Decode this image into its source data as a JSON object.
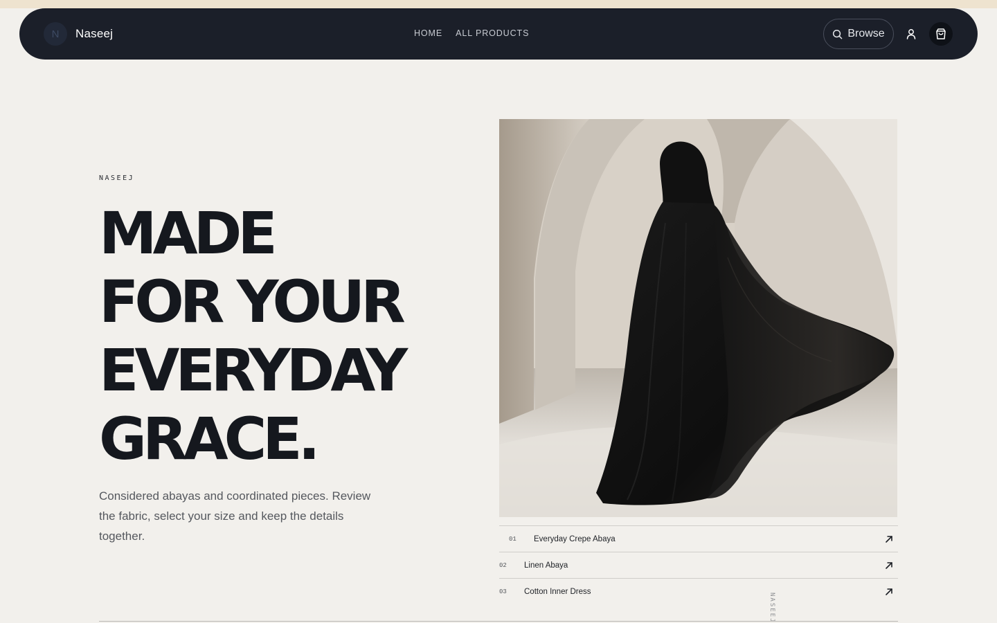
{
  "brand": {
    "mark": "N",
    "name": "Naseej"
  },
  "nav": {
    "links": [
      {
        "label": "HOME"
      },
      {
        "label": "ALL PRODUCTS"
      }
    ],
    "browse_label": "Browse",
    "icons": {
      "search": "search-icon",
      "user": "user-icon",
      "cart": "shopping-bag-icon"
    }
  },
  "hero": {
    "eyebrow": "NASEEJ",
    "title_lines": [
      "MADE",
      "FOR YOUR",
      "EVERYDAY",
      "GRACE."
    ],
    "description": "Considered abayas and coordinated pieces. Review the fabric, select your size and keep the details together."
  },
  "products": [
    {
      "num": "01",
      "name": "Everyday Crepe Abaya"
    },
    {
      "num": "02",
      "name": "Linen Abaya"
    },
    {
      "num": "03",
      "name": "Cotton Inner Dress"
    }
  ],
  "vertical_label": "NASEEJ",
  "colors": {
    "page_bg": "#f2f0ec",
    "nav_bg": "#1b1f29",
    "top_strip": "#eee3cf",
    "ink": "#15181e"
  }
}
